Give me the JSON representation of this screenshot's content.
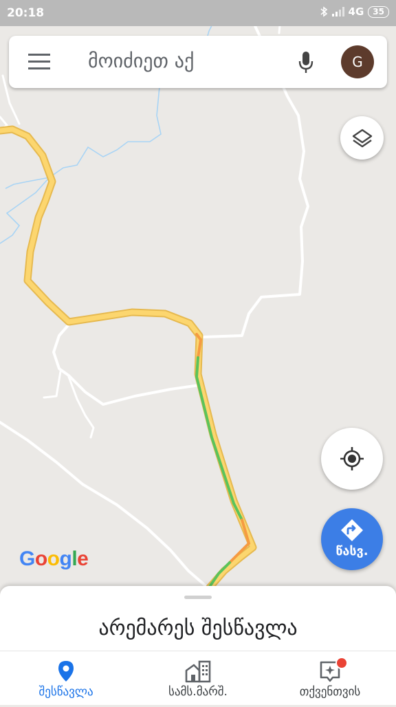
{
  "status_bar": {
    "time": "20:18",
    "network": "4G",
    "battery": "35"
  },
  "search": {
    "placeholder": "მოიძიეთ აქ",
    "avatar_letter": "G"
  },
  "go_button": {
    "label": "წასვ."
  },
  "google_logo": {
    "letters": [
      "G",
      "o",
      "o",
      "g",
      "l",
      "e"
    ],
    "colors": [
      "#4285F4",
      "#EA4335",
      "#FBBC05",
      "#4285F4",
      "#34A853",
      "#EA4335"
    ]
  },
  "bottom_sheet": {
    "title": "არემარეს შესწავლა"
  },
  "bottom_nav": {
    "items": [
      {
        "label": "შესწავლა"
      },
      {
        "label": "სამს.მარშ."
      },
      {
        "label": "თქვენთვის"
      }
    ]
  },
  "colors": {
    "accent": "#1a73e8",
    "go_button": "#3c7ee6",
    "route_yellow": "#fcd66f",
    "traffic_green": "#5bc35b",
    "traffic_orange": "#f59b42",
    "water": "#9ed1f5",
    "notification_dot": "#ea4335"
  },
  "icons": [
    "menu-icon",
    "microphone-icon",
    "layers-icon",
    "my-location-icon",
    "directions-icon",
    "explore-pin-icon",
    "commute-icon",
    "for-you-icon",
    "bluetooth-icon",
    "signal-icon"
  ]
}
